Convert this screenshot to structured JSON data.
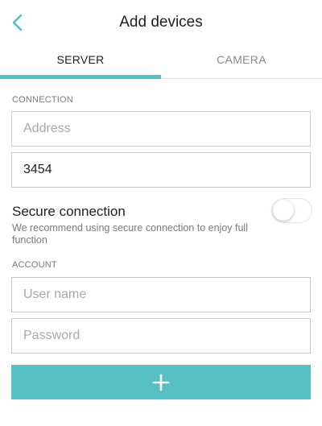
{
  "theme": {
    "accent": "#4dc2c4",
    "button_bg": "#55c1c4"
  },
  "header": {
    "title": "Add devices",
    "back_icon": "chevron-left-icon"
  },
  "tabs": [
    {
      "label": "SERVER",
      "active": true
    },
    {
      "label": "CAMERA",
      "active": false
    }
  ],
  "connection": {
    "section_label": "CONNECTION",
    "address": {
      "value": "",
      "placeholder": "Address"
    },
    "port": {
      "value": "3454",
      "placeholder": ""
    },
    "secure": {
      "title": "Secure connection",
      "description": "We recommend using secure connection to enjoy full function",
      "enabled": false
    }
  },
  "account": {
    "section_label": "ACCOUNT",
    "username": {
      "value": "",
      "placeholder": "User name"
    },
    "password": {
      "value": "",
      "placeholder": "Password"
    }
  },
  "add_button": {
    "icon": "plus-icon"
  }
}
